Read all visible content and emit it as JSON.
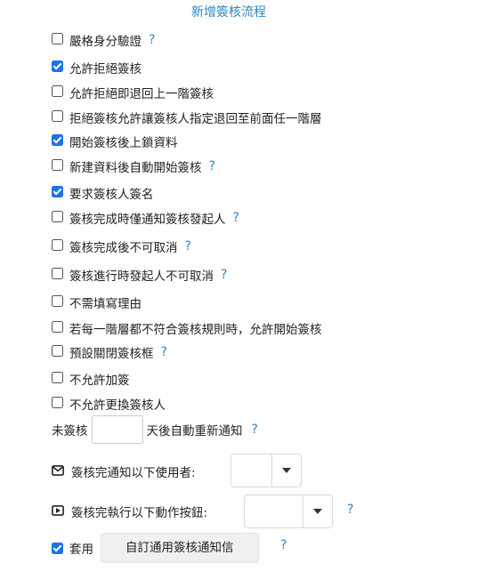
{
  "title": "新增簽核流程",
  "help_mark": "?",
  "options": [
    {
      "label": "嚴格身分驗證",
      "checked": false,
      "help": true
    },
    {
      "label": "允許拒絕簽核",
      "checked": true,
      "help": false
    },
    {
      "label": "允許拒絕即退回上一階簽核",
      "checked": false,
      "help": false
    },
    {
      "label": "拒絕簽核允許讓簽核人指定退回至前面任一階層",
      "checked": false,
      "help": false
    },
    {
      "label": "開始簽核後上鎖資料",
      "checked": true,
      "help": false
    },
    {
      "label": "新建資料後自動開始簽核",
      "checked": false,
      "help": true
    },
    {
      "label": "要求簽核人簽名",
      "checked": true,
      "help": false
    },
    {
      "label": "簽核完成時僅通知簽核發起人",
      "checked": false,
      "help": true
    },
    {
      "label": "簽核完成後不可取消",
      "checked": false,
      "help": true
    },
    {
      "label": "簽核進行時發起人不可取消",
      "checked": false,
      "help": true
    },
    {
      "label": "不需填寫理由",
      "checked": false,
      "help": false
    },
    {
      "label": "若每一階層都不符合簽核規則時，允許開始簽核",
      "checked": false,
      "help": false
    },
    {
      "label": "預設關閉簽核框",
      "checked": false,
      "help": true
    },
    {
      "label": "不允許加簽",
      "checked": false,
      "help": false
    },
    {
      "label": "不允許更換簽核人",
      "checked": false,
      "help": false
    }
  ],
  "reminder": {
    "prefix": "未簽核",
    "value": "",
    "suffix": "天後自動重新通知"
  },
  "notify_users": {
    "label": "簽核完通知以下使用者:",
    "icon": "envelope-icon",
    "selected": ""
  },
  "run_button": {
    "label": "簽核完執行以下動作按鈕:",
    "icon": "play-box-icon",
    "selected": ""
  },
  "custom_notice": {
    "checked": true,
    "label": "套用",
    "button_label": "自訂通用簽核通知信"
  },
  "colors": {
    "accent": "#2e86c9",
    "checkbox": "#1a73e8"
  }
}
